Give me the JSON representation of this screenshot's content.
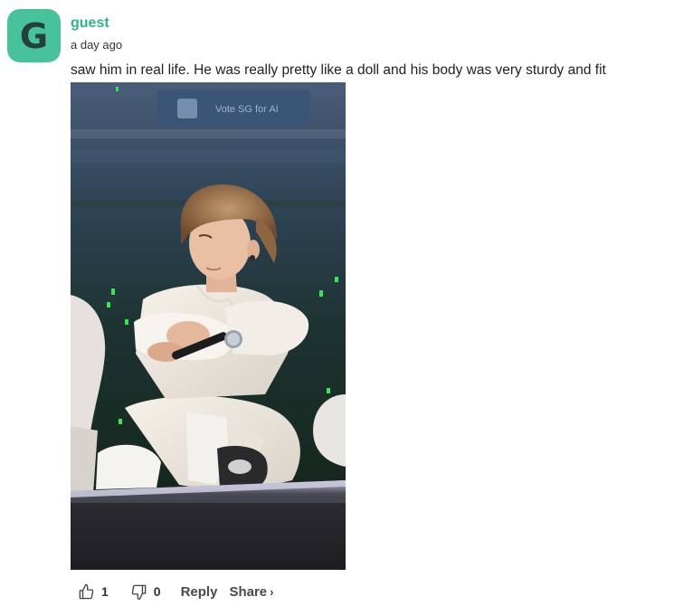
{
  "comment": {
    "avatar_letter": "G",
    "username": "guest",
    "timestamp": "a day ago",
    "text": "saw him in real life. He was really pretty like a doll and his body was very sturdy and fit",
    "image": {
      "description_icon": "photo-attachment",
      "banner_text": "Vote SG for AI"
    }
  },
  "actions": {
    "like_count": "1",
    "dislike_count": "0",
    "reply_label": "Reply",
    "share_label": "Share",
    "share_chevron": "›"
  },
  "colors": {
    "avatar_bg": "#47c29a",
    "username": "#34b088",
    "text": "#222222"
  }
}
